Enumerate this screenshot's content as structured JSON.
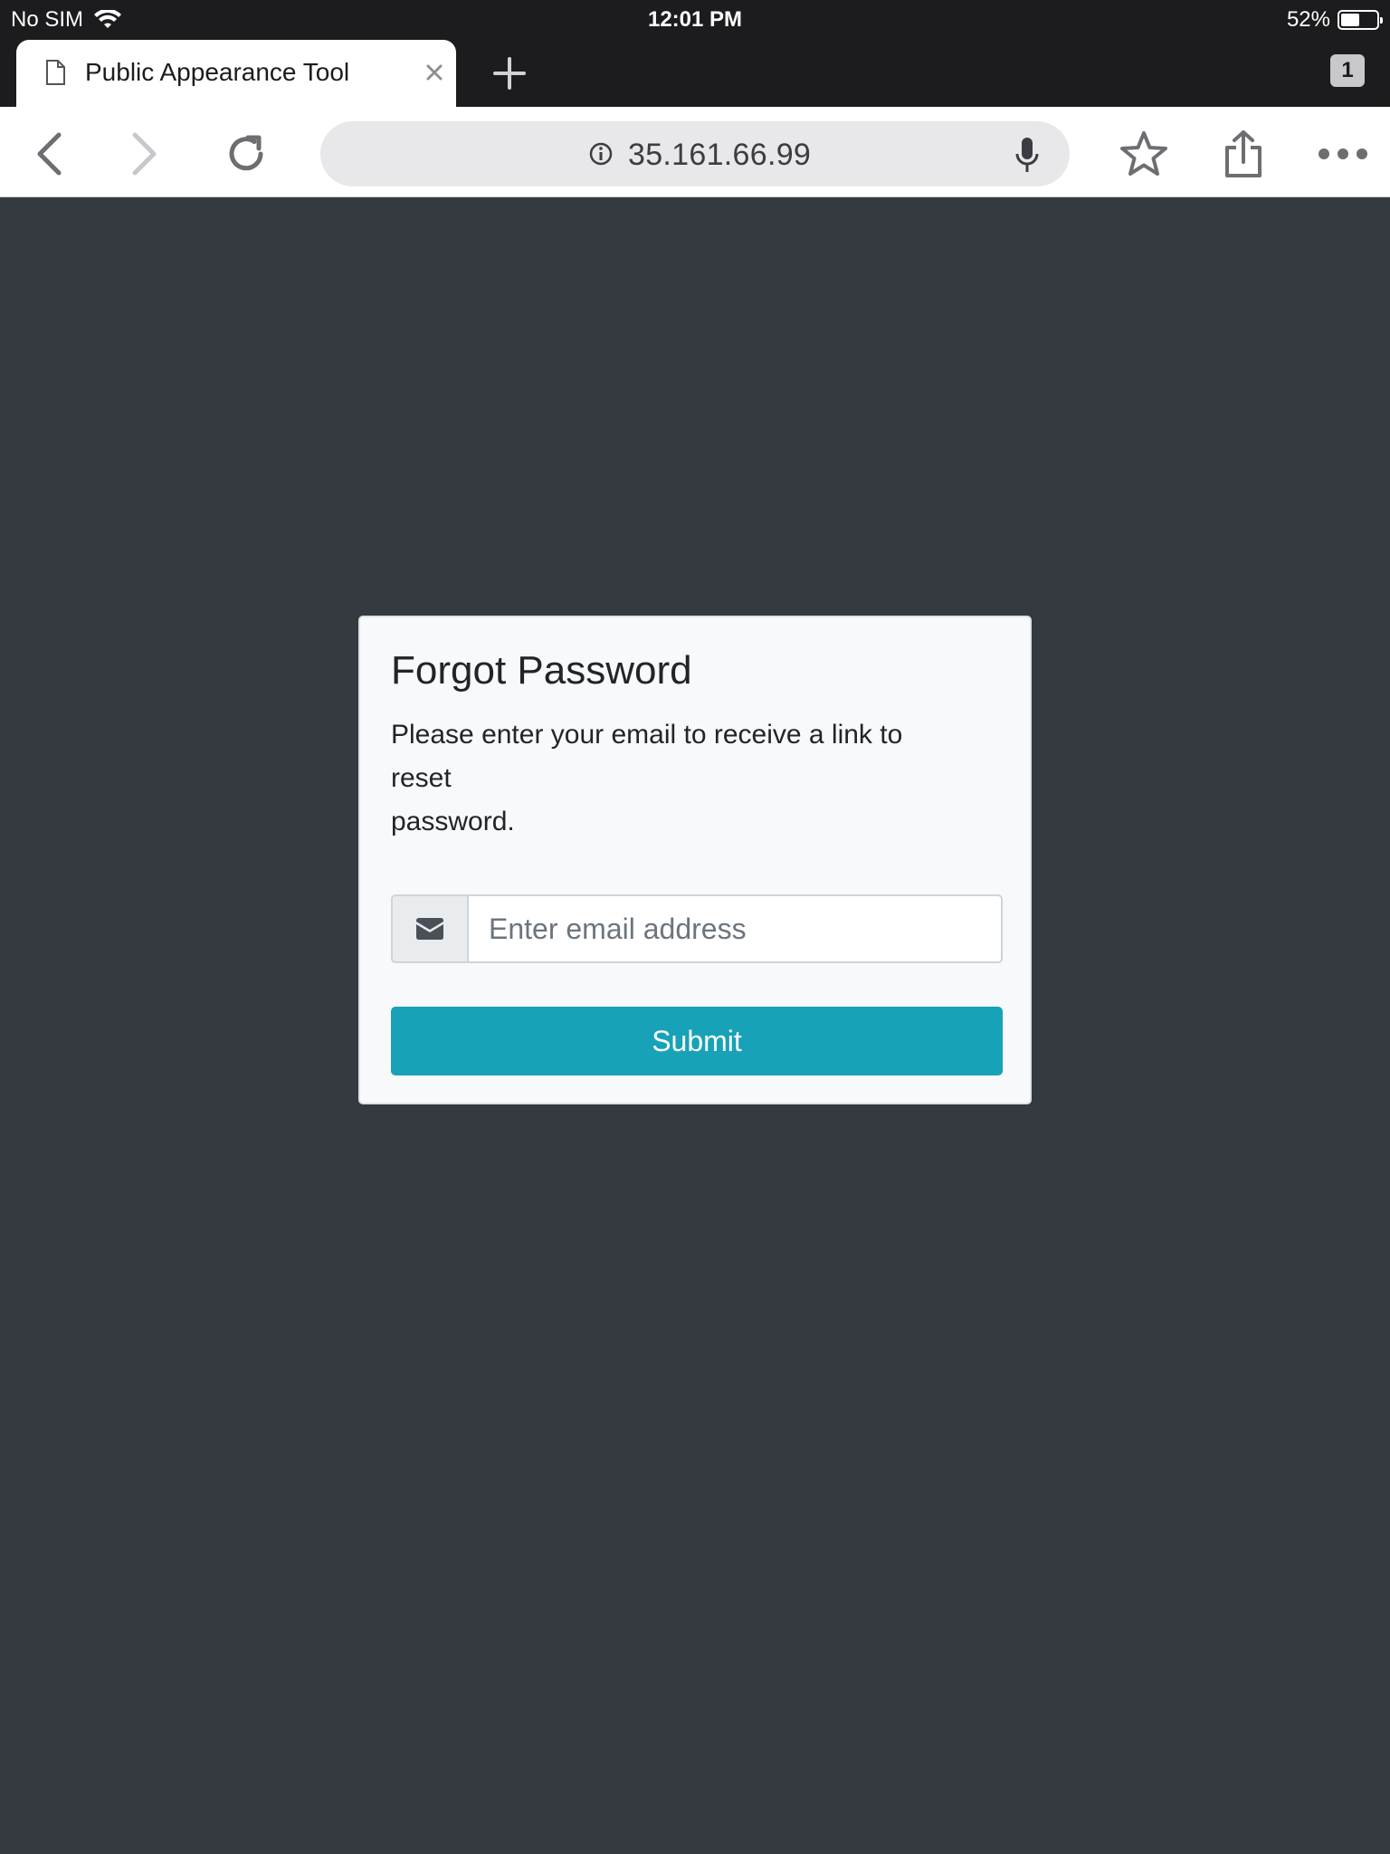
{
  "status_bar": {
    "carrier": "No SIM",
    "time": "12:01 PM",
    "battery_percent": "52%",
    "battery_level": 0.52
  },
  "browser": {
    "tab": {
      "title": "Public Appearance Tool",
      "close_glyph": "×"
    },
    "new_tab_glyph": "+",
    "tab_count": "1",
    "url": "35.161.66.99",
    "icons": {
      "back": "chevron-left-icon",
      "forward": "chevron-right-icon",
      "reload": "reload-icon",
      "info": "info-icon",
      "mic": "microphone-icon",
      "bookmark": "star-icon",
      "share": "share-icon",
      "menu": "more-horizontal-icon"
    }
  },
  "form": {
    "title": "Forgot Password",
    "description_lines": [
      "Please enter your email to receive a link to",
      "reset",
      "password."
    ],
    "email_placeholder": "Enter email address",
    "submit_label": "Submit"
  },
  "colors": {
    "page_background": "#343a40",
    "card_background": "#f8f9fa",
    "submit_button": "#17a2b8",
    "browser_chrome_dark": "#1c1c1e"
  }
}
